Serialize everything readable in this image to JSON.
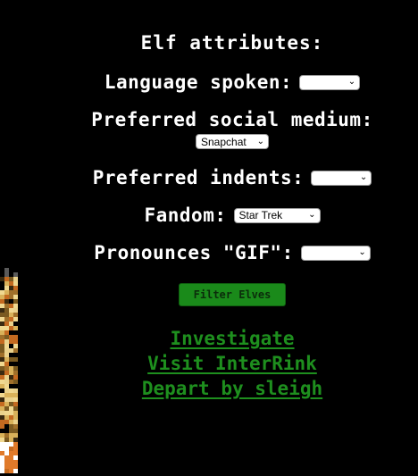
{
  "heading": "Elf attributes:",
  "fields": {
    "language": {
      "label": "Language spoken:",
      "value": ""
    },
    "social": {
      "label": "Preferred social medium:",
      "value": "Snapchat"
    },
    "indents": {
      "label": "Preferred indents:",
      "value": ""
    },
    "fandom": {
      "label": "Fandom:",
      "value": "Star Trek"
    },
    "gif": {
      "label": "Pronounces \"GIF\":",
      "value": ""
    }
  },
  "filter_button": "Filter Elves",
  "links": [
    "Investigate",
    "Visit InterRink",
    "Depart by sleigh"
  ],
  "colors": {
    "background": "#000000",
    "text": "#ffffff",
    "link": "#1e8f1e",
    "button": "#1a8a1a"
  },
  "icons": {
    "select_arrow": "chevron-down-icon",
    "left_sprite": "pixel-art-sprite"
  }
}
